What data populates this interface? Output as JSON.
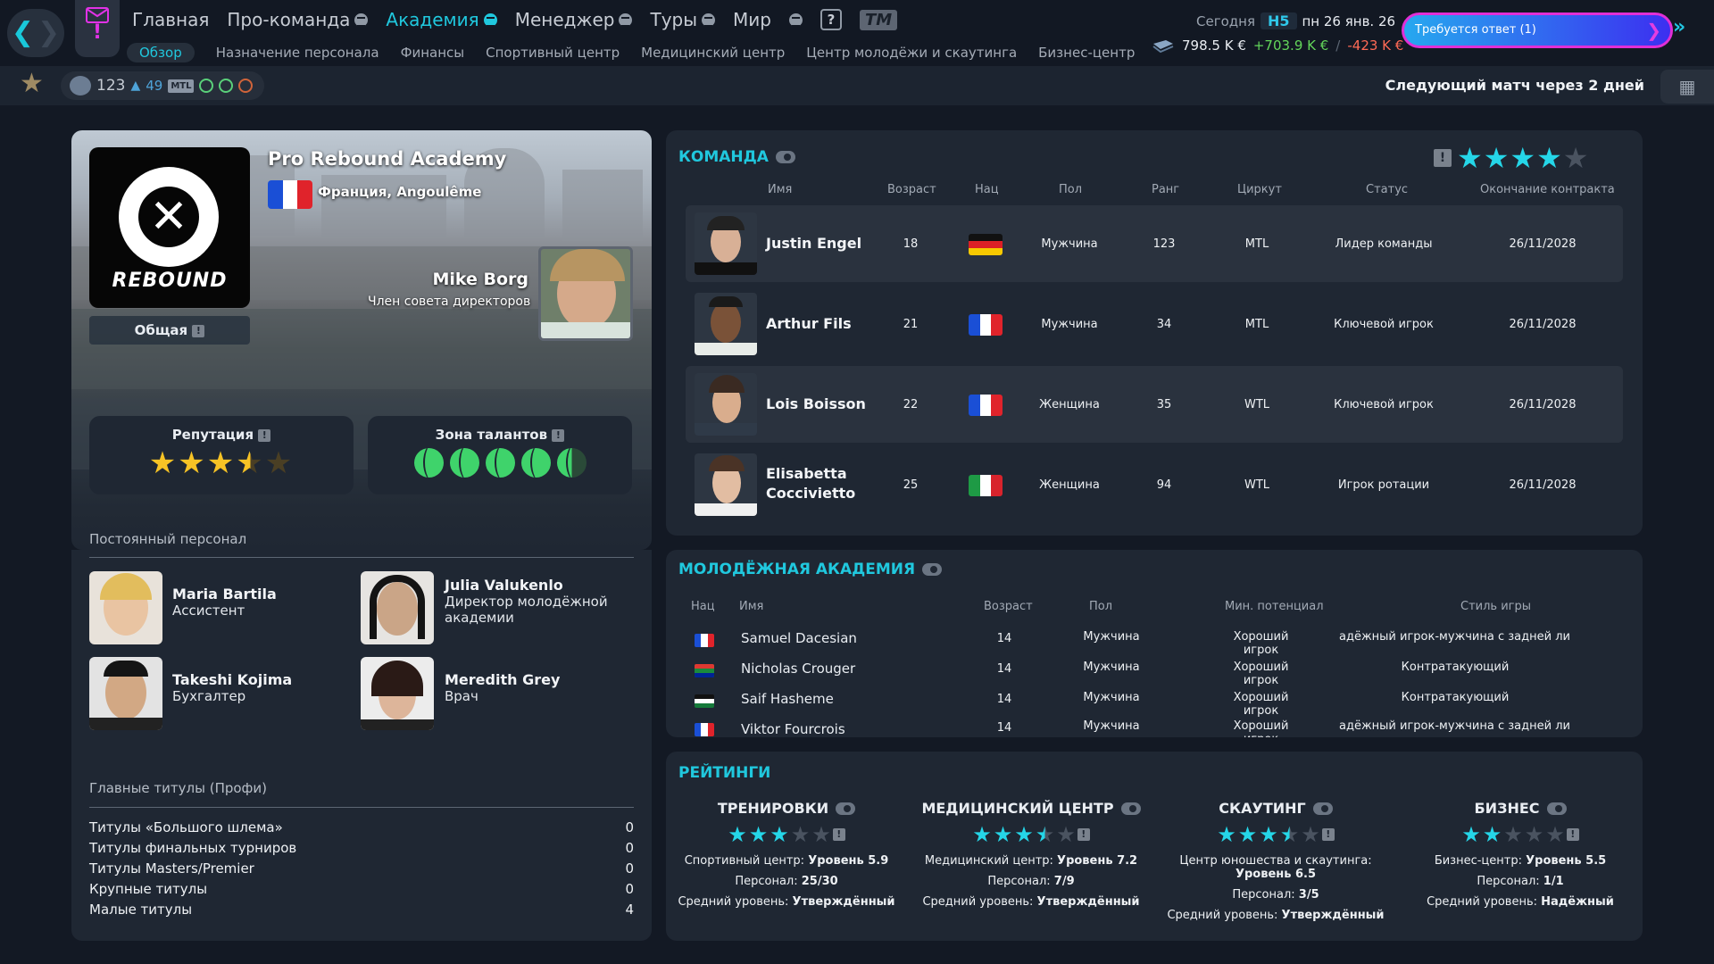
{
  "nav": {
    "menu": [
      "Главная",
      "Про-команда",
      "Академия",
      "Менеджер",
      "Туры",
      "Мир"
    ],
    "tm_label": "TM",
    "help_label": "?",
    "submenu": [
      "Обзор",
      "Назначение персонала",
      "Финансы",
      "Спортивный центр",
      "Медицинский центр",
      "Центр молодёжи и скаутинга",
      "Бизнес-центр"
    ]
  },
  "header": {
    "today_label": "Сегодня",
    "week": "Н5",
    "date": "пн 26 янв. 26",
    "balance": "798.5 K €",
    "income": "+703.9 K €",
    "expense": "-423 K €",
    "alert": "Требуется ответ (1)"
  },
  "statusbar": {
    "count": "123",
    "level": "49",
    "tour": "MTL",
    "next_match": "Следующий матч через 2 дней"
  },
  "academy": {
    "name": "Pro Rebound Academy",
    "location": "Франция, Angoulême",
    "logo_text": "REBOUND",
    "tab_label": "Общая",
    "manager_name": "Mike Borg",
    "manager_role": "Член совета директоров",
    "reputation_label": "Репутация",
    "reputation": 3.5,
    "talent_label": "Зона талантов",
    "talent": 4.5
  },
  "staff": {
    "title": "Постоянный персонал",
    "members": [
      {
        "name": "Maria Bartila",
        "role": "Ассистент"
      },
      {
        "name": "Julia Valukenlo",
        "role": "Директор молодёжной академии"
      },
      {
        "name": "Takeshi Kojima",
        "role": "Бухгалтер"
      },
      {
        "name": "Meredith Grey",
        "role": "Врач"
      }
    ]
  },
  "titles": {
    "title": "Главные титулы (Профи)",
    "rows": [
      {
        "label": "Титулы «Большого шлема»",
        "value": "0"
      },
      {
        "label": "Титулы финальных турниров",
        "value": "0"
      },
      {
        "label": "Титулы Masters/Premier",
        "value": "0"
      },
      {
        "label": "Крупные титулы",
        "value": "0"
      },
      {
        "label": "Малые титулы",
        "value": "4"
      }
    ]
  },
  "team": {
    "title": "КОМАНДА",
    "rating": 4,
    "columns": [
      "Имя",
      "Возраст",
      "Нац",
      "Пол",
      "Ранг",
      "Циркут",
      "Статус",
      "Окончание контракта"
    ],
    "players": [
      {
        "name": "Justin Engel",
        "age": "18",
        "flag": "de",
        "gender": "Мужчина",
        "rank": "123",
        "circuit": "MTL",
        "status": "Лидер команды",
        "contract": "26/11/2028"
      },
      {
        "name": "Arthur Fils",
        "age": "21",
        "flag": "fr",
        "gender": "Мужчина",
        "rank": "34",
        "circuit": "MTL",
        "status": "Ключевой игрок",
        "contract": "26/11/2028"
      },
      {
        "name": "Lois Boisson",
        "age": "22",
        "flag": "fr",
        "gender": "Женщина",
        "rank": "35",
        "circuit": "WTL",
        "status": "Ключевой игрок",
        "contract": "26/11/2028"
      },
      {
        "name": "Elisabetta Cocciviet­to",
        "age": "25",
        "flag": "it",
        "gender": "Женщина",
        "rank": "94",
        "circuit": "WTL",
        "status": "Игрок ротации",
        "contract": "26/11/2028"
      }
    ]
  },
  "youth": {
    "title": "МОЛОДЁЖНАЯ АКАДЕМИЯ",
    "columns": [
      "Нац",
      "Имя",
      "Возраст",
      "Пол",
      "Мин. потенциал",
      "Стиль игры"
    ],
    "players": [
      {
        "flag": "fr",
        "name": "Samuel Dacesian",
        "age": "14",
        "gender": "Мужчина",
        "potential": "Хороший игрок",
        "style": "адёжный игрок-мужчина с задней лини"
      },
      {
        "flag": "za",
        "name": "Nicholas Crouger",
        "age": "14",
        "gender": "Мужчина",
        "potential": "Хороший игрок",
        "style": "Контратакующий"
      },
      {
        "flag": "jo",
        "name": "Saif Hasheme",
        "age": "14",
        "gender": "Мужчина",
        "potential": "Хороший игрок",
        "style": "Контратакующий"
      },
      {
        "flag": "fr",
        "name": "Viktor Fourcrois",
        "age": "14",
        "gender": "Мужчина",
        "potential": "Хороший игрок",
        "style": "адёжный игрок-мужчина с задней лини"
      }
    ]
  },
  "ratings": {
    "title": "РЕЙТИНГИ",
    "facility_label": "Персонал:",
    "avg_label": "Средний уровень:",
    "items": [
      {
        "name": "ТРЕНИРОВКИ",
        "stars": 3,
        "facility": "Спортивный центр:",
        "level": "Уровень 5.9",
        "staff": "25/30",
        "avg": "Утверждённый"
      },
      {
        "name": "МЕДИЦИНСКИЙ ЦЕНТР",
        "stars": 3.5,
        "facility": "Медицинский центр:",
        "level": "Уровень 7.2",
        "staff": "7/9",
        "avg": "Утверждённый"
      },
      {
        "name": "СКАУТИНГ",
        "stars": 3.5,
        "facility": "Центр юношества и скаутинга:",
        "level": "Уровень 6.5",
        "staff": "3/5",
        "avg": "Утверждённый"
      },
      {
        "name": "БИЗНЕС",
        "stars": 2,
        "facility": "Бизнес-центр:",
        "level": "Уровень 5.5",
        "staff": "1/1",
        "avg": "Надёжный"
      }
    ]
  },
  "colors": {
    "accent": "#20c8de",
    "alert": "#e132e6",
    "gold": "#f7c325",
    "positive": "#63d65a",
    "negative": "#ff6a55"
  }
}
